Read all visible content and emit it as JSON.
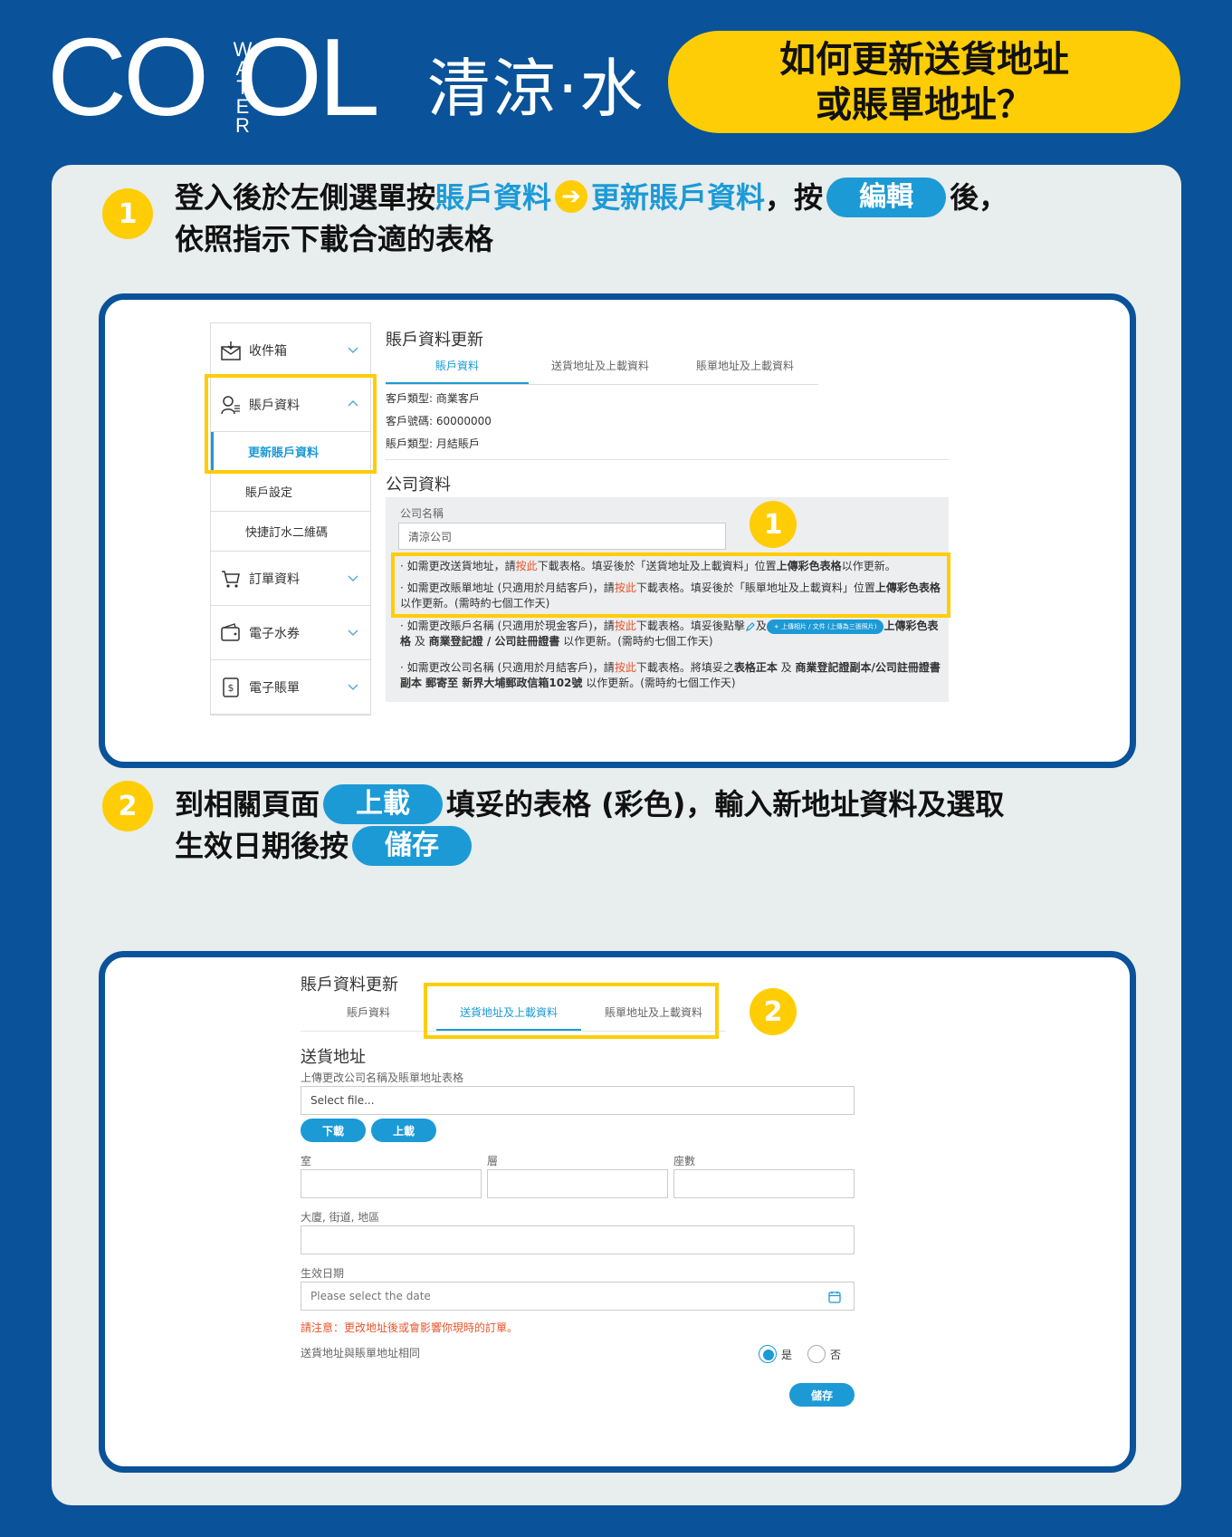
{
  "header": {
    "logo_left": "CO",
    "logo_right": "OL",
    "logo_vertical": [
      "W",
      "A",
      "T",
      "E",
      "R"
    ],
    "logo_cn": "清涼·水",
    "title_line1": "如何更新送貨地址",
    "title_line2": "或賬單地址？"
  },
  "step1": {
    "number": "1",
    "text_a": "登入後於左側選單按",
    "link1": "賬戶資料",
    "arrow": "➔",
    "link2": "更新賬戶資料",
    "text_b": "，按",
    "button": "編輯",
    "text_c": "後，",
    "line2": "依照指示下載合適的表格"
  },
  "step2": {
    "number": "2",
    "text_a": "到相關頁面",
    "button1": "上載",
    "text_b": "填妥的表格 (彩色)，輸入新地址資料及選取",
    "line2": "生效日期後按",
    "button2": "儲存"
  },
  "shot1": {
    "sidebar": {
      "inbox": "收件箱",
      "account": "賬戶資料",
      "update_account": "更新賬戶資料",
      "account_settings": "賬戶設定",
      "quick_order_qr": "快捷訂水二維碼",
      "order_info": "訂單資料",
      "e_coupon": "電子水券",
      "e_bill": "電子賬單"
    },
    "title": "賬戶資料更新",
    "tabs": [
      "賬戶資料",
      "送貨地址及上載資料",
      "賬單地址及上載資料"
    ],
    "customer_type": "客戶類型: 商業客戶",
    "customer_no": "客戶號碼: 60000000",
    "account_type": "賬戶類型: 月結賬戶",
    "company_section": "公司資料",
    "company_name_label": "公司名稱",
    "company_name_value": "清涼公司",
    "badge": "1",
    "note1": {
      "a": "· 如需更改送貨地址，請",
      "link": "按此",
      "b": "下載表格。填妥後於「送貨地址及上載資料」位置",
      "bold": "上傳彩色表格",
      "c": "以作更新。"
    },
    "note2": {
      "a": "· 如需更改賬單地址 (只適用於月結客戶)，請",
      "link": "按此",
      "b": "下載表格。填妥後於「賬單地址及上載資料」位置",
      "bold": "上傳彩色表格",
      "c": "以作更新。(需時約七個工作天)"
    },
    "note3": {
      "a": "· 如需更改賬戶名稱 (只適用於現金客戶)，請",
      "link": "按此",
      "b": "下載表格。填妥後點擊",
      "c": "及",
      "pill": "+ 上傳相片 / 文件 (上傳為三張照片)",
      "bold1": "上傳彩色表",
      "bold2": "格",
      "d": " 及 ",
      "bold3": "商業登記證 / 公司註冊證書",
      "e": " 以作更新。(需時約七個工作天)"
    },
    "note4": {
      "a": "· 如需更改公司名稱 (只適用於月結客戶)，請",
      "link": "按此",
      "b": "下載表格。將填妥之",
      "bold1": "表格正本",
      "c": " 及 ",
      "bold2": "商業登記證副本/公司註冊證書",
      "bold3": "副本 郵寄至 新界大埔郵政信箱102號",
      "d": " 以作更新。(需時約七個工作天)"
    }
  },
  "shot2": {
    "title": "賬戶資料更新",
    "tabs": [
      "賬戶資料",
      "送貨地址及上載資料",
      "賬單地址及上載資料"
    ],
    "badge": "2",
    "section": "送貨地址",
    "upload_label": "上傳更改公司名稱及賬單地址表格",
    "file_placeholder": "Select file...",
    "download_btn": "下載",
    "upload_btn": "上載",
    "room_label": "室",
    "floor_label": "層",
    "block_label": "座數",
    "street_label": "大廈, 街道, 地區",
    "date_label": "生效日期",
    "date_placeholder": "Please select the date",
    "warning": "請注意：更改地址後或會影響你現時的訂單。",
    "same_label": "送貨地址與賬單地址相同",
    "yes": "是",
    "no": "否",
    "save_btn": "儲存"
  }
}
